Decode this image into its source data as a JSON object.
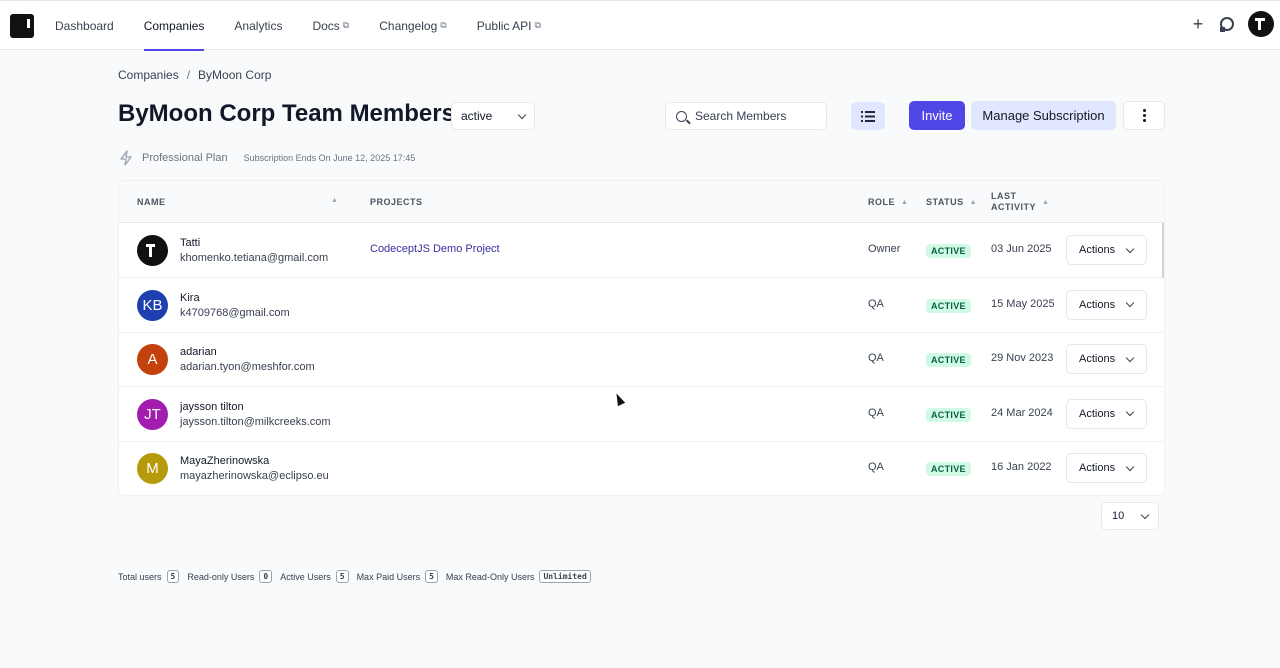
{
  "nav": {
    "items": [
      {
        "label": "Dashboard",
        "external": false
      },
      {
        "label": "Companies",
        "external": false
      },
      {
        "label": "Analytics",
        "external": false
      },
      {
        "label": "Docs",
        "external": true
      },
      {
        "label": "Changelog",
        "external": true
      },
      {
        "label": "Public API",
        "external": true
      }
    ],
    "active_index": 1,
    "ext_glyph": "⧉"
  },
  "breadcrumb": {
    "root": "Companies",
    "sep": "/",
    "current": "ByMoon Corp"
  },
  "header": {
    "title": "ByMoon Corp Team Members",
    "status_filter": "active",
    "search_placeholder": "Search Members",
    "invite_label": "Invite",
    "manage_label": "Manage Subscription"
  },
  "plan": {
    "name": "Professional Plan",
    "ends": "Subscription Ends On June 12, 2025 17:45"
  },
  "table": {
    "columns": {
      "name": "NAME",
      "projects": "PROJECTS",
      "role": "ROLE",
      "status": "STATUS",
      "last_activity_1": "LAST",
      "last_activity_2": "ACTIVITY"
    },
    "rows": [
      {
        "name": "Tatti",
        "email": "khomenko.tetiana@gmail.com",
        "project": "CodeceptJS Demo Project",
        "role": "Owner",
        "status": "ACTIVE",
        "date": "03 Jun 2025",
        "initials": "",
        "color": "#111111"
      },
      {
        "name": "Kira",
        "email": "k4709768@gmail.com",
        "project": "",
        "role": "QA",
        "status": "ACTIVE",
        "date": "15 May 2025",
        "initials": "KB",
        "color": "#1e40af"
      },
      {
        "name": "adarian",
        "email": "adarian.tyon@meshfor.com",
        "project": "",
        "role": "QA",
        "status": "ACTIVE",
        "date": "29 Nov 2023",
        "initials": "A",
        "color": "#c2410c"
      },
      {
        "name": "jaysson tilton",
        "email": "jaysson.tilton@milkcreeks.com",
        "project": "",
        "role": "QA",
        "status": "ACTIVE",
        "date": "24 Mar 2024",
        "initials": "JT",
        "color": "#a21caf"
      },
      {
        "name": "MayaZherinowska",
        "email": "mayazherinowska@eclipso.eu",
        "project": "",
        "role": "QA",
        "status": "ACTIVE",
        "date": "16 Jan 2022",
        "initials": "M",
        "color": "#b59b0b"
      }
    ],
    "actions_label": "Actions"
  },
  "pager": {
    "page_size": "10"
  },
  "stats": [
    {
      "label": "Total users",
      "value": "5"
    },
    {
      "label": "Read-only Users",
      "value": "0"
    },
    {
      "label": "Active Users",
      "value": "5"
    },
    {
      "label": "Max Paid Users",
      "value": "5"
    },
    {
      "label": "Max Read-Only Users",
      "value": "Unlimited"
    }
  ]
}
